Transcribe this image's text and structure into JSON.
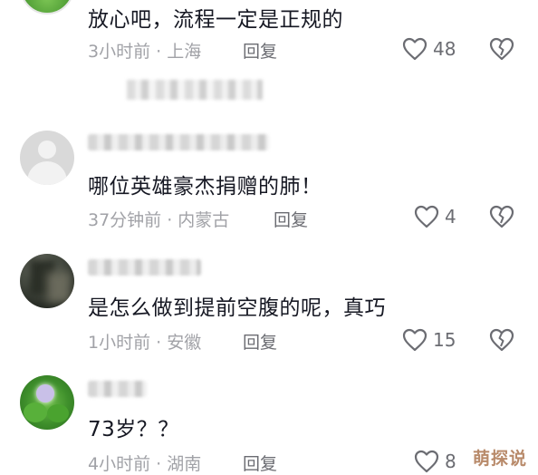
{
  "comments": [
    {
      "text": "放心吧，流程一定是正规的",
      "time_location": "3小时前 · 上海",
      "reply_label": "回复",
      "likes": "48",
      "avatar": "green-avatar"
    },
    {
      "text": "哪位英雄豪杰捐赠的肺！",
      "time_location": "37分钟前 · 内蒙古",
      "reply_label": "回复",
      "likes": "4",
      "avatar": "default-grey-avatar"
    },
    {
      "text": "是怎么做到提前空腹的呢，真巧",
      "time_location": "1小时前 · 安徽",
      "reply_label": "回复",
      "likes": "15",
      "avatar": "dark-photo-avatar"
    },
    {
      "text": "73岁？？",
      "time_location": "4小时前 · 湖南",
      "reply_label": "回复",
      "likes": "8",
      "avatar": "green-flower-avatar"
    }
  ],
  "icons": {
    "like": "heart-outline-icon",
    "dislike": "broken-heart-icon"
  },
  "colors": {
    "text": "#161823",
    "meta": "#a1a2a7",
    "action": "#6b6c72"
  },
  "watermark": "萌探说"
}
